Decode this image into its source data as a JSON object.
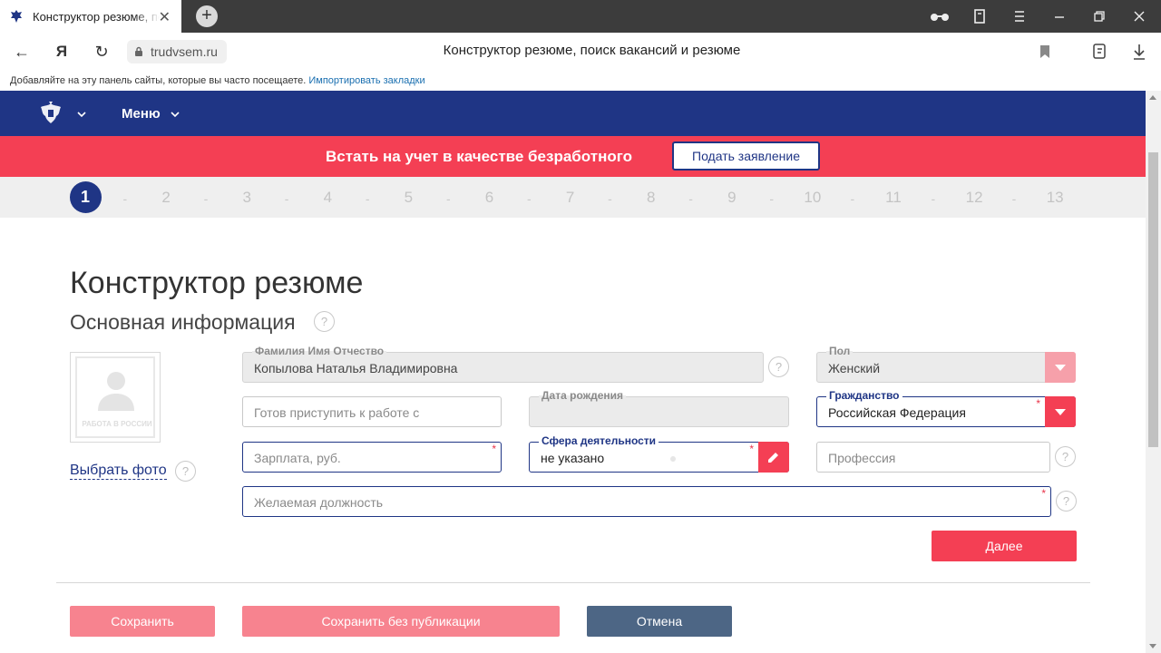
{
  "browser": {
    "tab_title": "Конструктор резюме, поиск вакансий и резюме",
    "tab_close": "✕",
    "new_tab": "+",
    "back": "←",
    "home": "Я",
    "reload": "↻",
    "url": "trudvsem.ru",
    "page_title": "Конструктор резюме, поиск вакансий и резюме",
    "bookmarks_hint": "Добавляйте на эту панель сайты, которые вы часто посещаете.",
    "bookmarks_import": "Импортировать закладки"
  },
  "site": {
    "menu_label": "Меню",
    "banner_text": "Встать на учет в качестве безработного",
    "banner_button": "Подать заявление"
  },
  "steps": {
    "active": "1",
    "items": [
      "1",
      "2",
      "3",
      "4",
      "5",
      "6",
      "7",
      "8",
      "9",
      "10",
      "11",
      "12",
      "13"
    ],
    "separator": "-"
  },
  "form": {
    "title": "Конструктор резюме",
    "subtitle": "Основная информация",
    "help": "?",
    "photo_watermark": "РАБОТА В РОССИИ",
    "photo_link": "Выбрать фото",
    "fio_label": "Фамилия Имя Отчество",
    "fio_value": "Копылова Наталья Владимировна",
    "gender_label": "Пол",
    "gender_value": "Женский",
    "start_placeholder": "Готов приступить к работе с",
    "birth_label": "Дата рождения",
    "birth_value": "",
    "citizenship_label": "Гражданство",
    "citizenship_value": "Российская Федерация",
    "salary_placeholder": "Зарплата, руб.",
    "sphere_label": "Сфера деятельности",
    "sphere_value": "не указано",
    "profession_placeholder": "Профессия",
    "position_placeholder": "Желаемая должность",
    "required_mark": "*",
    "next_button": "Далее"
  },
  "actions": {
    "save": "Сохранить",
    "save_unpublished": "Сохранить без публикации",
    "cancel": "Отмена"
  },
  "colors": {
    "navy": "#1f3585",
    "red": "#f43f54",
    "pink": "#f7838f",
    "slate": "#4d6685"
  }
}
